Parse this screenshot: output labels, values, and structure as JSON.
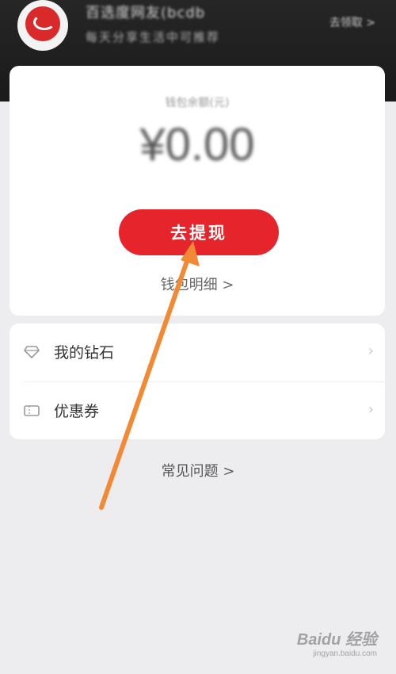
{
  "header": {
    "user_name": "百选度网友(bcdb",
    "user_subtitle": "每天分享生活中可推荐",
    "header_link": "去领取 >"
  },
  "wallet": {
    "balance_label": "钱包余额(元)",
    "balance_amount": "¥0.00",
    "withdraw_label": "去提现",
    "detail_link": "钱包明细 >"
  },
  "list": {
    "items": [
      {
        "label": "我的钻石",
        "icon": "diamond-icon"
      },
      {
        "label": "优惠券",
        "icon": "coupon-icon"
      }
    ]
  },
  "faq_link": "常见问题 >",
  "colors": {
    "accent": "#e5242b",
    "arrow": "#f28a35",
    "header_bg": "#1f1f1f"
  },
  "watermark": {
    "brand": "Baidu 经验",
    "url": "jingyan.baidu.com"
  }
}
